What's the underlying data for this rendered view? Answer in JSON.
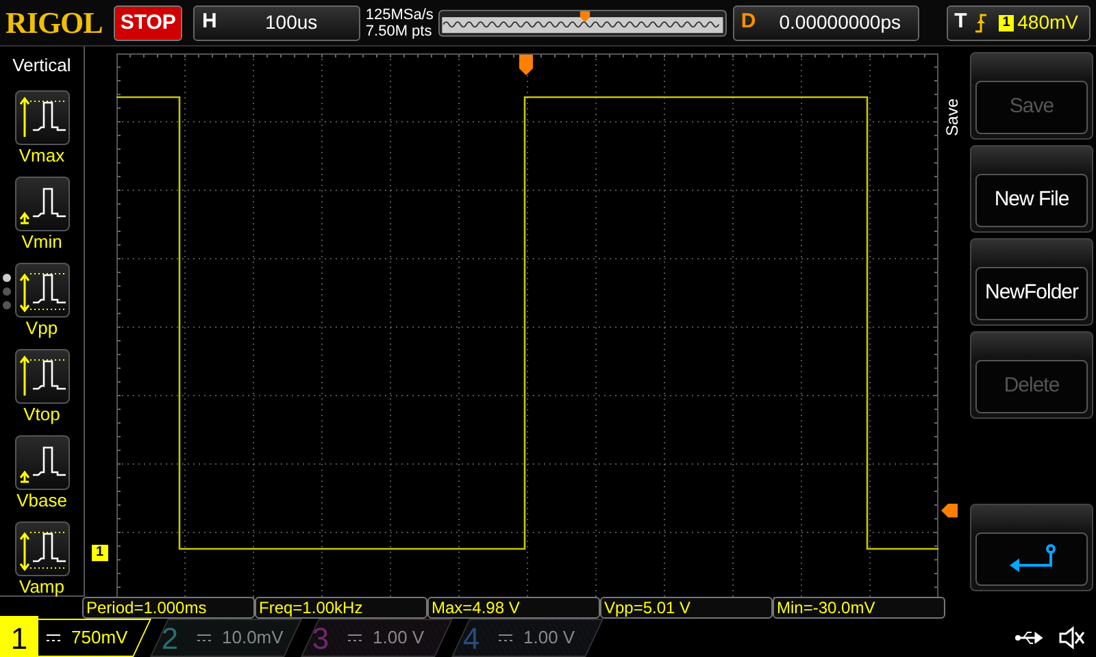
{
  "brand": "RIGOL",
  "run_state": "STOP",
  "timebase": {
    "label": "H",
    "value": "100us"
  },
  "sample": {
    "rate": "125MSa/s",
    "points": "7.50M pts"
  },
  "delay": {
    "label": "D",
    "value": "0.00000000ps"
  },
  "trigger": {
    "label": "T",
    "channel": "1",
    "level": "480mV"
  },
  "left_menu": {
    "title": "Vertical",
    "items": [
      {
        "label": "Vmax",
        "kind": "max"
      },
      {
        "label": "Vmin",
        "kind": "min"
      },
      {
        "label": "Vpp",
        "kind": "pp"
      },
      {
        "label": "Vtop",
        "kind": "top"
      },
      {
        "label": "Vbase",
        "kind": "base"
      },
      {
        "label": "Vamp",
        "kind": "amp"
      }
    ]
  },
  "page_dots": [
    {
      "selected": true
    },
    {
      "selected": false
    },
    {
      "selected": false
    }
  ],
  "channel_marker": "1",
  "right_menu": {
    "title": "Save",
    "buttons": [
      {
        "kind": "text",
        "label": "Save",
        "disabled": true
      },
      {
        "kind": "text",
        "label": "New File",
        "disabled": false
      },
      {
        "kind": "text",
        "label": "NewFolder",
        "disabled": false
      },
      {
        "kind": "text",
        "label": "Delete",
        "disabled": true
      },
      {
        "kind": "return"
      }
    ]
  },
  "measurements": [
    "Period=1.000ms",
    "Freq=1.00kHz",
    "Max=4.98 V",
    "Vpp=5.01 V",
    "Min=-30.0mV"
  ],
  "channels": [
    {
      "number": "1",
      "scale": "750mV",
      "on": true,
      "color": "#ffff00"
    },
    {
      "number": "2",
      "scale": "10.0mV",
      "on": false,
      "color": "#2a6e6e"
    },
    {
      "number": "3",
      "scale": "1.00 V",
      "on": false,
      "color": "#6e2a6e"
    },
    {
      "number": "4",
      "scale": "1.00 V",
      "on": false,
      "color": "#2a4a7a"
    }
  ]
}
